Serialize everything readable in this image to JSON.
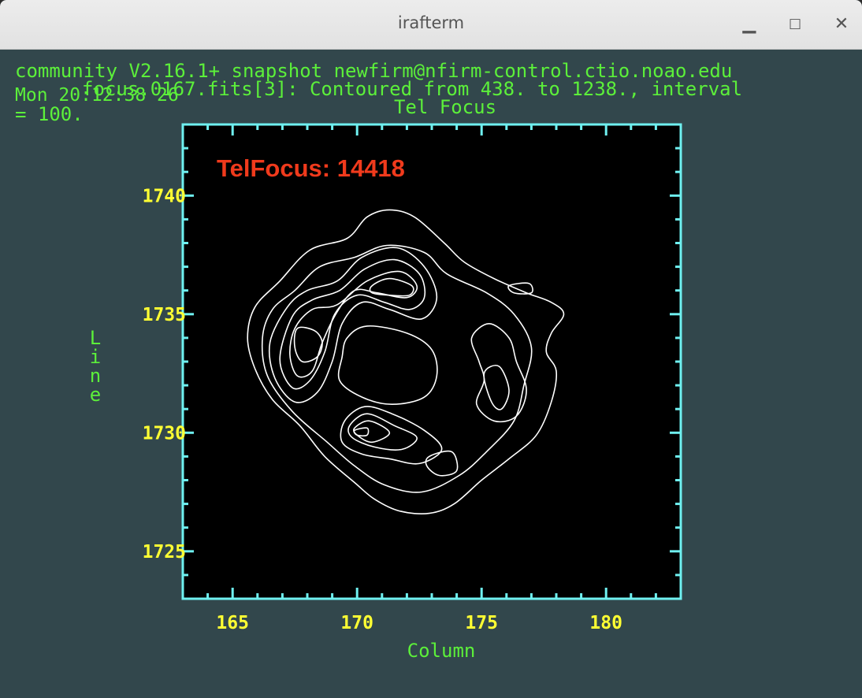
{
  "window": {
    "title": "irafterm",
    "minimize_icon": "minimize-icon",
    "maximize_icon": "maximize-icon",
    "close_icon": "close-icon"
  },
  "terminal": {
    "line1": "community V2.16.1+ snapshot newfirm@nfirm-control.ctio.noao.edu",
    "line2": "Mon 20:12:38 26",
    "line2_overlay": "focus.0167.fits[3]: Contoured from 438. to 1238., interval",
    "line3": "= 100."
  },
  "colors": {
    "terminal_text": "#5cf03a",
    "tick_labels": "#ffff33",
    "frame": "#6ff0f0",
    "contours": "#ffffff",
    "annotation": "#f03a1c",
    "background": "#32474c"
  },
  "chart_data": {
    "type": "contour",
    "title": "Tel Focus",
    "xlabel": "Column",
    "ylabel": "Line",
    "xlim": [
      163,
      183
    ],
    "ylim": [
      1723,
      1743
    ],
    "x_ticks": [
      "165",
      "170",
      "175",
      "180"
    ],
    "y_ticks": [
      "1740",
      "1735",
      "1730",
      "1725"
    ],
    "contour_range": [
      438,
      1238
    ],
    "contour_interval": 100,
    "annotation": "TelFocus: 14418",
    "contours": [
      {
        "level": "outer-1",
        "points": [
          [
            166.9,
            1736.4
          ],
          [
            168.1,
            1737.7
          ],
          [
            169.6,
            1738.2
          ],
          [
            170.4,
            1739.1
          ],
          [
            171.3,
            1739.4
          ],
          [
            172.3,
            1739.1
          ],
          [
            173.5,
            1738.0
          ],
          [
            174.3,
            1737.2
          ],
          [
            175.5,
            1736.5
          ],
          [
            176.8,
            1735.9
          ],
          [
            177.8,
            1735.5
          ],
          [
            178.3,
            1735.0
          ],
          [
            177.8,
            1734.2
          ],
          [
            177.6,
            1733.4
          ],
          [
            178.0,
            1732.6
          ],
          [
            177.8,
            1731.3
          ],
          [
            177.2,
            1729.9
          ],
          [
            176.1,
            1728.9
          ],
          [
            175.0,
            1728.0
          ],
          [
            173.9,
            1727.0
          ],
          [
            172.9,
            1726.6
          ],
          [
            171.7,
            1726.7
          ],
          [
            170.7,
            1727.2
          ],
          [
            169.9,
            1727.9
          ],
          [
            168.7,
            1729.0
          ],
          [
            167.7,
            1730.3
          ],
          [
            166.6,
            1731.4
          ],
          [
            165.9,
            1732.7
          ],
          [
            165.6,
            1734.0
          ],
          [
            165.9,
            1735.3
          ],
          [
            166.9,
            1736.4
          ]
        ]
      },
      {
        "level": "outer-2",
        "points": [
          [
            167.5,
            1736.0
          ],
          [
            168.5,
            1737.0
          ],
          [
            169.9,
            1737.4
          ],
          [
            171.2,
            1737.9
          ],
          [
            172.7,
            1737.6
          ],
          [
            173.6,
            1736.7
          ],
          [
            175.2,
            1735.9
          ],
          [
            176.3,
            1735.0
          ],
          [
            177.0,
            1733.6
          ],
          [
            176.7,
            1732.0
          ],
          [
            176.3,
            1730.5
          ],
          [
            175.2,
            1729.2
          ],
          [
            174.1,
            1728.2
          ],
          [
            172.6,
            1727.5
          ],
          [
            171.1,
            1727.8
          ],
          [
            169.9,
            1728.6
          ],
          [
            168.8,
            1729.6
          ],
          [
            167.4,
            1730.9
          ],
          [
            166.4,
            1732.4
          ],
          [
            166.2,
            1734.0
          ],
          [
            166.6,
            1735.2
          ],
          [
            167.5,
            1736.0
          ]
        ]
      },
      {
        "level": "mid-1",
        "points": [
          [
            167.2,
            1735.3
          ],
          [
            168.0,
            1736.0
          ],
          [
            169.2,
            1736.4
          ],
          [
            170.2,
            1737.4
          ],
          [
            171.6,
            1737.8
          ],
          [
            172.7,
            1737.0
          ],
          [
            173.2,
            1735.7
          ],
          [
            172.6,
            1734.8
          ],
          [
            171.3,
            1735.2
          ],
          [
            170.2,
            1735.5
          ],
          [
            169.4,
            1734.6
          ],
          [
            169.0,
            1733.0
          ],
          [
            168.4,
            1731.7
          ],
          [
            167.5,
            1731.3
          ],
          [
            166.7,
            1732.3
          ],
          [
            166.5,
            1733.8
          ],
          [
            167.2,
            1735.3
          ]
        ]
      },
      {
        "level": "mid-2",
        "points": [
          [
            167.4,
            1734.9
          ],
          [
            168.2,
            1735.6
          ],
          [
            169.3,
            1736.0
          ],
          [
            170.3,
            1736.9
          ],
          [
            171.5,
            1737.3
          ],
          [
            172.5,
            1736.7
          ],
          [
            172.7,
            1735.7
          ],
          [
            172.1,
            1735.2
          ],
          [
            171.1,
            1735.5
          ],
          [
            170.0,
            1735.8
          ],
          [
            169.1,
            1735.0
          ],
          [
            168.7,
            1733.4
          ],
          [
            168.1,
            1732.2
          ],
          [
            167.4,
            1731.9
          ],
          [
            166.9,
            1733.1
          ],
          [
            167.4,
            1734.9
          ]
        ]
      },
      {
        "level": "mid-3",
        "points": [
          [
            167.5,
            1734.4
          ],
          [
            168.2,
            1735.2
          ],
          [
            169.2,
            1735.4
          ],
          [
            170.4,
            1736.4
          ],
          [
            171.7,
            1736.8
          ],
          [
            172.4,
            1736.2
          ],
          [
            172.0,
            1735.7
          ],
          [
            170.8,
            1735.9
          ],
          [
            169.9,
            1736.0
          ],
          [
            169.2,
            1735.1
          ],
          [
            168.6,
            1733.8
          ],
          [
            168.2,
            1732.6
          ],
          [
            167.6,
            1732.4
          ],
          [
            167.3,
            1733.3
          ],
          [
            167.5,
            1734.4
          ]
        ]
      },
      {
        "level": "peak-a",
        "points": [
          [
            167.6,
            1734.4
          ],
          [
            168.3,
            1734.3
          ],
          [
            168.6,
            1733.8
          ],
          [
            168.4,
            1733.2
          ],
          [
            167.8,
            1733.0
          ],
          [
            167.5,
            1733.6
          ],
          [
            167.6,
            1734.4
          ]
        ]
      },
      {
        "level": "peak-b",
        "points": [
          [
            170.6,
            1736.2
          ],
          [
            171.3,
            1736.5
          ],
          [
            172.2,
            1736.2
          ],
          [
            172.1,
            1735.8
          ],
          [
            171.3,
            1735.8
          ],
          [
            170.6,
            1735.9
          ],
          [
            170.6,
            1736.2
          ]
        ]
      },
      {
        "level": "hole",
        "points": [
          [
            169.6,
            1734.0
          ],
          [
            170.4,
            1734.5
          ],
          [
            172.0,
            1734.2
          ],
          [
            173.0,
            1733.5
          ],
          [
            173.2,
            1732.4
          ],
          [
            172.7,
            1731.5
          ],
          [
            171.4,
            1731.2
          ],
          [
            170.2,
            1731.5
          ],
          [
            169.3,
            1732.2
          ],
          [
            169.4,
            1733.2
          ],
          [
            169.6,
            1734.0
          ]
        ]
      },
      {
        "level": "right-lobe-1",
        "points": [
          [
            174.6,
            1734.0
          ],
          [
            175.3,
            1734.6
          ],
          [
            176.1,
            1734.0
          ],
          [
            176.4,
            1733.0
          ],
          [
            176.8,
            1731.8
          ],
          [
            176.4,
            1730.7
          ],
          [
            175.5,
            1730.5
          ],
          [
            174.8,
            1731.2
          ],
          [
            175.1,
            1732.2
          ],
          [
            174.9,
            1733.0
          ],
          [
            174.6,
            1734.0
          ]
        ]
      },
      {
        "level": "right-lobe-2",
        "points": [
          [
            175.1,
            1732.5
          ],
          [
            175.7,
            1732.8
          ],
          [
            176.1,
            1731.8
          ],
          [
            175.8,
            1731.0
          ],
          [
            175.4,
            1731.3
          ],
          [
            175.1,
            1732.5
          ]
        ]
      },
      {
        "level": "small-right",
        "points": [
          [
            176.1,
            1736.2
          ],
          [
            176.9,
            1736.3
          ],
          [
            177.0,
            1735.9
          ],
          [
            176.3,
            1735.9
          ],
          [
            176.1,
            1736.2
          ]
        ]
      },
      {
        "level": "low-1",
        "points": [
          [
            169.5,
            1730.5
          ],
          [
            170.3,
            1731.1
          ],
          [
            171.4,
            1730.8
          ],
          [
            172.7,
            1730.1
          ],
          [
            173.4,
            1729.3
          ],
          [
            172.5,
            1728.7
          ],
          [
            171.3,
            1728.9
          ],
          [
            170.2,
            1729.1
          ],
          [
            169.4,
            1729.6
          ],
          [
            169.5,
            1730.5
          ]
        ]
      },
      {
        "level": "low-2",
        "points": [
          [
            169.7,
            1730.3
          ],
          [
            170.4,
            1730.8
          ],
          [
            171.5,
            1730.3
          ],
          [
            172.4,
            1729.8
          ],
          [
            171.8,
            1729.3
          ],
          [
            170.7,
            1729.4
          ],
          [
            169.8,
            1729.8
          ],
          [
            169.7,
            1730.3
          ]
        ]
      },
      {
        "level": "low-3",
        "points": [
          [
            169.9,
            1730.2
          ],
          [
            170.5,
            1730.5
          ],
          [
            171.3,
            1730.0
          ],
          [
            170.6,
            1729.6
          ],
          [
            170.0,
            1729.9
          ],
          [
            169.9,
            1730.2
          ]
        ]
      },
      {
        "level": "low-peak",
        "points": [
          [
            169.9,
            1730.1
          ],
          [
            170.4,
            1730.2
          ],
          [
            170.4,
            1729.9
          ],
          [
            170.0,
            1729.9
          ],
          [
            169.9,
            1730.1
          ]
        ]
      },
      {
        "level": "low-right",
        "points": [
          [
            172.9,
            1729.0
          ],
          [
            173.8,
            1729.2
          ],
          [
            174.0,
            1728.4
          ],
          [
            173.3,
            1728.2
          ],
          [
            172.8,
            1728.6
          ],
          [
            172.9,
            1729.0
          ]
        ]
      }
    ]
  }
}
